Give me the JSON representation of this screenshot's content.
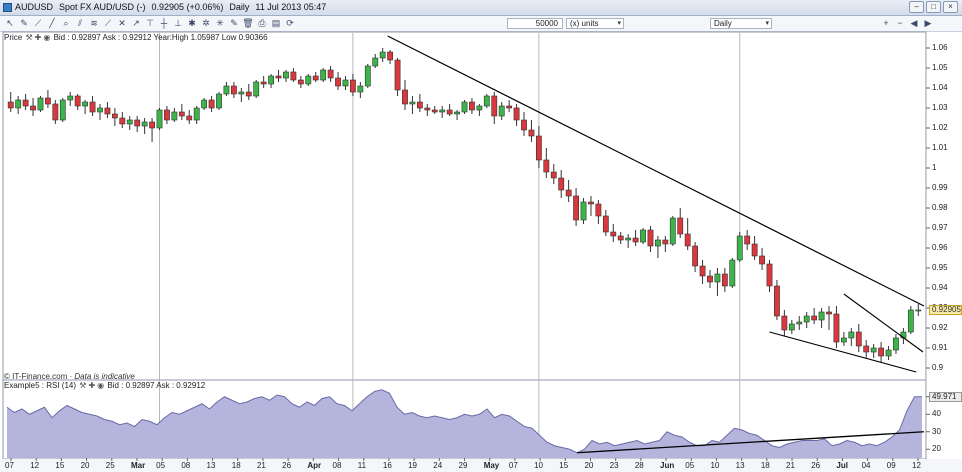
{
  "window": {
    "title_symbol": "AUDUSD",
    "title_desc": "Spot FX AUD/USD (-)",
    "title_price": "0.92905 (+0.06%)",
    "title_period": "Daily",
    "title_datetime": "11 Jul 2013 05:47"
  },
  "toolbar": {
    "amount": "50000",
    "units": "(x) units",
    "period": "Daily",
    "icons": [
      "pointer-icon",
      "pencil-icon",
      "ruler-icon",
      "trendline-icon",
      "zoom-icon",
      "channel-icon",
      "fib-icon",
      "text-icon",
      "crosshair-icon",
      "arrow-icon",
      "shape-icon",
      "hline-icon",
      "vline-icon",
      "cross-icon",
      "multi-icon",
      "settings-icon",
      "gallery-icon",
      "delete-icon",
      "print-icon",
      "export-icon",
      "refresh-icon"
    ]
  },
  "price_panel": {
    "label": "Price",
    "bid_text": "Bid : 0.92897",
    "ask_text": "Ask : 0.92912",
    "year_text": "Year:High 1.05987",
    "low_text": "Low 0.90366",
    "footer_brand": "IT-Finance.com",
    "footer_note": "Data is indicative",
    "last_price": "0.92905"
  },
  "rsi_panel": {
    "label": "Example5 : RSI (14)",
    "bid_text": "Bid : 0.92897",
    "ask_text": "Ask : 0.92912",
    "last_value": "49.971"
  },
  "colors": {
    "up": "#3cb44a",
    "down": "#d9383e",
    "rsi_fill": "#b4b4dc",
    "rsi_line": "#6a6aa8",
    "trendline": "#000000",
    "grid": "#c8c8c8"
  },
  "chart_data": [
    {
      "type": "candlestick",
      "title": "AUDUSD Daily",
      "ylim": [
        0.895,
        1.065
      ],
      "y_ticks": [
        "1.06",
        "1.05",
        "1.04",
        "1.03",
        "1.02",
        "1.01",
        "1",
        "0.99",
        "0.98",
        "0.97",
        "0.96",
        "0.95",
        "0.94",
        "0.93",
        "0.92",
        "0.91",
        "0.9"
      ],
      "x_ticks": [
        "07",
        "12",
        "15",
        "20",
        "25",
        "Mar",
        "05",
        "08",
        "13",
        "18",
        "21",
        "26",
        "Apr",
        "08",
        "11",
        "16",
        "19",
        "24",
        "29",
        "May",
        "07",
        "10",
        "15",
        "20",
        "23",
        "28",
        "Jun",
        "05",
        "10",
        "13",
        "18",
        "21",
        "26",
        "Jul",
        "04",
        "09",
        "12"
      ],
      "month_boundaries": [
        "Mar",
        "Apr",
        "May",
        "Jun",
        "Jul"
      ],
      "ohlc": [
        [
          1.033,
          1.038,
          1.028,
          1.03
        ],
        [
          1.03,
          1.036,
          1.027,
          1.034
        ],
        [
          1.034,
          1.037,
          1.029,
          1.031
        ],
        [
          1.031,
          1.035,
          1.026,
          1.029
        ],
        [
          1.029,
          1.036,
          1.028,
          1.035
        ],
        [
          1.035,
          1.039,
          1.03,
          1.032
        ],
        [
          1.032,
          1.034,
          1.022,
          1.024
        ],
        [
          1.024,
          1.035,
          1.023,
          1.034
        ],
        [
          1.034,
          1.038,
          1.031,
          1.036
        ],
        [
          1.036,
          1.037,
          1.029,
          1.031
        ],
        [
          1.031,
          1.034,
          1.027,
          1.033
        ],
        [
          1.033,
          1.036,
          1.026,
          1.028
        ],
        [
          1.028,
          1.032,
          1.024,
          1.03
        ],
        [
          1.03,
          1.033,
          1.025,
          1.027
        ],
        [
          1.027,
          1.03,
          1.021,
          1.025
        ],
        [
          1.025,
          1.028,
          1.02,
          1.022
        ],
        [
          1.022,
          1.026,
          1.019,
          1.024
        ],
        [
          1.024,
          1.026,
          1.018,
          1.021
        ],
        [
          1.021,
          1.025,
          1.017,
          1.023
        ],
        [
          1.023,
          1.025,
          1.013,
          1.02
        ],
        [
          1.02,
          1.03,
          1.019,
          1.029
        ],
        [
          1.029,
          1.031,
          1.022,
          1.024
        ],
        [
          1.024,
          1.03,
          1.023,
          1.028
        ],
        [
          1.028,
          1.032,
          1.024,
          1.026
        ],
        [
          1.026,
          1.029,
          1.022,
          1.024
        ],
        [
          1.024,
          1.031,
          1.022,
          1.03
        ],
        [
          1.03,
          1.035,
          1.029,
          1.034
        ],
        [
          1.034,
          1.036,
          1.028,
          1.03
        ],
        [
          1.03,
          1.038,
          1.029,
          1.037
        ],
        [
          1.037,
          1.043,
          1.036,
          1.041
        ],
        [
          1.041,
          1.043,
          1.035,
          1.037
        ],
        [
          1.037,
          1.04,
          1.033,
          1.038
        ],
        [
          1.038,
          1.042,
          1.034,
          1.036
        ],
        [
          1.036,
          1.044,
          1.035,
          1.043
        ],
        [
          1.043,
          1.046,
          1.04,
          1.042
        ],
        [
          1.042,
          1.047,
          1.04,
          1.046
        ],
        [
          1.046,
          1.049,
          1.043,
          1.045
        ],
        [
          1.045,
          1.049,
          1.043,
          1.048
        ],
        [
          1.048,
          1.05,
          1.043,
          1.044
        ],
        [
          1.044,
          1.046,
          1.04,
          1.042
        ],
        [
          1.042,
          1.047,
          1.041,
          1.046
        ],
        [
          1.046,
          1.048,
          1.043,
          1.044
        ],
        [
          1.044,
          1.05,
          1.043,
          1.049
        ],
        [
          1.049,
          1.051,
          1.043,
          1.045
        ],
        [
          1.045,
          1.048,
          1.039,
          1.041
        ],
        [
          1.041,
          1.046,
          1.039,
          1.044
        ],
        [
          1.044,
          1.047,
          1.036,
          1.038
        ],
        [
          1.038,
          1.043,
          1.035,
          1.041
        ],
        [
          1.041,
          1.052,
          1.04,
          1.051
        ],
        [
          1.051,
          1.057,
          1.05,
          1.055
        ],
        [
          1.055,
          1.06,
          1.053,
          1.058
        ],
        [
          1.058,
          1.059,
          1.052,
          1.054
        ],
        [
          1.054,
          1.055,
          1.036,
          1.039
        ],
        [
          1.039,
          1.044,
          1.029,
          1.032
        ],
        [
          1.032,
          1.036,
          1.027,
          1.033
        ],
        [
          1.033,
          1.037,
          1.028,
          1.03
        ],
        [
          1.03,
          1.032,
          1.026,
          1.029
        ],
        [
          1.029,
          1.031,
          1.027,
          1.028
        ],
        [
          1.028,
          1.031,
          1.025,
          1.029
        ],
        [
          1.029,
          1.032,
          1.026,
          1.027
        ],
        [
          1.027,
          1.029,
          1.024,
          1.028
        ],
        [
          1.028,
          1.034,
          1.027,
          1.033
        ],
        [
          1.033,
          1.035,
          1.027,
          1.029
        ],
        [
          1.029,
          1.032,
          1.026,
          1.031
        ],
        [
          1.031,
          1.037,
          1.03,
          1.036
        ],
        [
          1.036,
          1.038,
          1.022,
          1.026
        ],
        [
          1.026,
          1.033,
          1.024,
          1.031
        ],
        [
          1.031,
          1.034,
          1.028,
          1.03
        ],
        [
          1.03,
          1.032,
          1.021,
          1.024
        ],
        [
          1.024,
          1.028,
          1.016,
          1.019
        ],
        [
          1.019,
          1.024,
          1.013,
          1.016
        ],
        [
          1.016,
          1.021,
          1.0,
          1.004
        ],
        [
          1.004,
          1.01,
          0.995,
          0.998
        ],
        [
          0.998,
          1.002,
          0.992,
          0.995
        ],
        [
          0.995,
          0.999,
          0.985,
          0.989
        ],
        [
          0.989,
          0.994,
          0.983,
          0.986
        ],
        [
          0.986,
          0.99,
          0.971,
          0.974
        ],
        [
          0.974,
          0.985,
          0.972,
          0.983
        ],
        [
          0.983,
          0.986,
          0.976,
          0.982
        ],
        [
          0.982,
          0.984,
          0.972,
          0.976
        ],
        [
          0.976,
          0.979,
          0.966,
          0.968
        ],
        [
          0.968,
          0.972,
          0.963,
          0.966
        ],
        [
          0.966,
          0.968,
          0.962,
          0.964
        ],
        [
          0.964,
          0.967,
          0.96,
          0.965
        ],
        [
          0.965,
          0.969,
          0.961,
          0.963
        ],
        [
          0.963,
          0.97,
          0.962,
          0.969
        ],
        [
          0.969,
          0.971,
          0.958,
          0.961
        ],
        [
          0.961,
          0.966,
          0.955,
          0.964
        ],
        [
          0.964,
          0.966,
          0.958,
          0.962
        ],
        [
          0.962,
          0.976,
          0.961,
          0.975
        ],
        [
          0.975,
          0.98,
          0.965,
          0.967
        ],
        [
          0.967,
          0.975,
          0.959,
          0.961
        ],
        [
          0.961,
          0.963,
          0.948,
          0.951
        ],
        [
          0.951,
          0.954,
          0.942,
          0.946
        ],
        [
          0.946,
          0.949,
          0.94,
          0.943
        ],
        [
          0.943,
          0.95,
          0.936,
          0.947
        ],
        [
          0.947,
          0.95,
          0.938,
          0.941
        ],
        [
          0.941,
          0.955,
          0.94,
          0.954
        ],
        [
          0.954,
          0.968,
          0.953,
          0.966
        ],
        [
          0.966,
          0.969,
          0.959,
          0.962
        ],
        [
          0.962,
          0.966,
          0.954,
          0.956
        ],
        [
          0.956,
          0.96,
          0.949,
          0.952
        ],
        [
          0.952,
          0.954,
          0.938,
          0.941
        ],
        [
          0.941,
          0.944,
          0.924,
          0.926
        ],
        [
          0.926,
          0.929,
          0.916,
          0.919
        ],
        [
          0.919,
          0.924,
          0.917,
          0.922
        ],
        [
          0.922,
          0.926,
          0.919,
          0.923
        ],
        [
          0.923,
          0.928,
          0.92,
          0.926
        ],
        [
          0.926,
          0.93,
          0.922,
          0.924
        ],
        [
          0.924,
          0.93,
          0.92,
          0.928
        ],
        [
          0.928,
          0.931,
          0.919,
          0.927
        ],
        [
          0.927,
          0.931,
          0.91,
          0.913
        ],
        [
          0.913,
          0.918,
          0.911,
          0.915
        ],
        [
          0.915,
          0.92,
          0.911,
          0.918
        ],
        [
          0.918,
          0.922,
          0.908,
          0.911
        ],
        [
          0.911,
          0.914,
          0.905,
          0.908
        ],
        [
          0.908,
          0.912,
          0.905,
          0.91
        ],
        [
          0.91,
          0.913,
          0.903,
          0.906
        ],
        [
          0.906,
          0.911,
          0.904,
          0.909
        ],
        [
          0.909,
          0.917,
          0.907,
          0.915
        ],
        [
          0.915,
          0.92,
          0.912,
          0.918
        ],
        [
          0.918,
          0.931,
          0.917,
          0.929
        ],
        [
          0.929,
          0.932,
          0.926,
          0.929
        ]
      ],
      "annotations": [
        "descending trendline from Apr high",
        "falling wedge late Jun–Jul"
      ]
    },
    {
      "type": "area",
      "title": "RSI (14)",
      "ylim": [
        15,
        55
      ],
      "y_ticks": [
        "50",
        "40",
        "30",
        "20"
      ],
      "values": [
        44,
        41,
        43,
        40,
        42,
        44,
        38,
        42,
        45,
        43,
        41,
        40,
        39,
        37,
        36,
        34,
        35,
        33,
        37,
        36,
        34,
        38,
        41,
        40,
        42,
        44,
        46,
        43,
        47,
        50,
        48,
        46,
        47,
        49,
        50,
        48,
        51,
        50,
        46,
        44,
        47,
        45,
        49,
        50,
        46,
        45,
        42,
        46,
        50,
        53,
        54,
        52,
        44,
        40,
        41,
        39,
        38,
        39,
        38,
        37,
        38,
        40,
        39,
        40,
        43,
        38,
        40,
        39,
        36,
        33,
        32,
        28,
        24,
        22,
        21,
        20,
        18,
        20,
        25,
        23,
        24,
        22,
        23,
        24,
        25,
        23,
        24,
        25,
        30,
        28,
        27,
        24,
        22,
        22,
        25,
        24,
        28,
        32,
        31,
        29,
        28,
        25,
        22,
        21,
        23,
        24,
        25,
        25,
        25,
        26,
        22,
        23,
        25,
        24,
        22,
        23,
        22,
        24,
        27,
        31,
        42,
        50,
        50
      ],
      "annotations": [
        "rising support line on RSI lows"
      ]
    }
  ]
}
